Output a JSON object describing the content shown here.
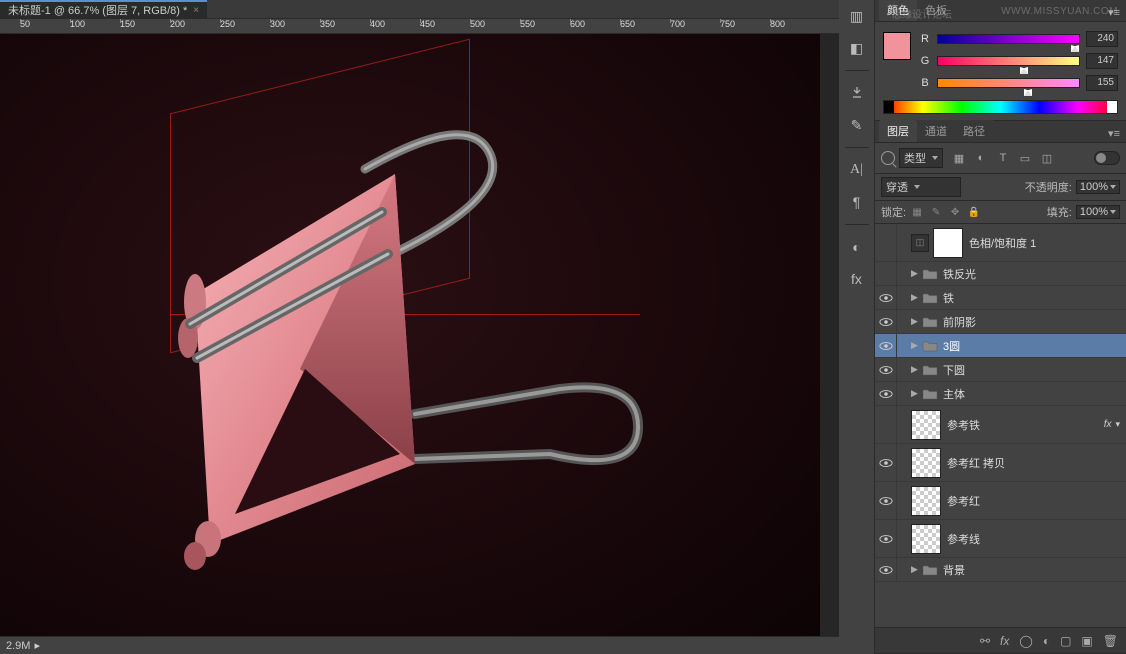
{
  "doc_title": "未标题-1 @ 66.7% (图层 7, RGB/8) *",
  "ruler_marks": [
    "50",
    "100",
    "150",
    "200",
    "250",
    "300",
    "350",
    "400",
    "450",
    "500",
    "550",
    "600",
    "650",
    "700",
    "750",
    "800"
  ],
  "status": {
    "doc_size": "2.9M"
  },
  "color_panel": {
    "tabs": [
      "颜色",
      "色板"
    ],
    "active_tab": 0,
    "r": {
      "label": "R",
      "value": "240",
      "pos": 94
    },
    "g": {
      "label": "G",
      "value": "147",
      "pos": 58
    },
    "b": {
      "label": "B",
      "value": "155",
      "pos": 61
    }
  },
  "layer_panel": {
    "tabs": [
      "图层",
      "通道",
      "路径"
    ],
    "active_tab": 0,
    "filter_label": "类型",
    "blend_mode": "穿透",
    "opacity_label": "不透明度:",
    "opacity_value": "100%",
    "lock_label": "锁定:",
    "fill_label": "填充:",
    "fill_value": "100%"
  },
  "layers": [
    {
      "type": "adj",
      "name": "色相/饱和度 1",
      "vis": false
    },
    {
      "type": "folder",
      "name": "铁反光",
      "vis": false
    },
    {
      "type": "folder",
      "name": "铁",
      "vis": true
    },
    {
      "type": "folder",
      "name": "前阴影",
      "vis": true
    },
    {
      "type": "folder",
      "name": "3圆",
      "vis": true,
      "selected": true
    },
    {
      "type": "folder",
      "name": "下圆",
      "vis": true
    },
    {
      "type": "folder",
      "name": "主体",
      "vis": true
    },
    {
      "type": "layer",
      "name": "参考铁",
      "vis": false,
      "fx": true,
      "checker": true
    },
    {
      "type": "layer",
      "name": "参考红 拷贝",
      "vis": true,
      "checker": true
    },
    {
      "type": "layer",
      "name": "参考红",
      "vis": true,
      "checker": true
    },
    {
      "type": "layer",
      "name": "参考线",
      "vis": true,
      "checker": true
    },
    {
      "type": "folder",
      "name": "背景",
      "vis": true
    }
  ],
  "watermark": "WWW.MISSYUAN.COM",
  "watermark2": "思缘设计论坛"
}
